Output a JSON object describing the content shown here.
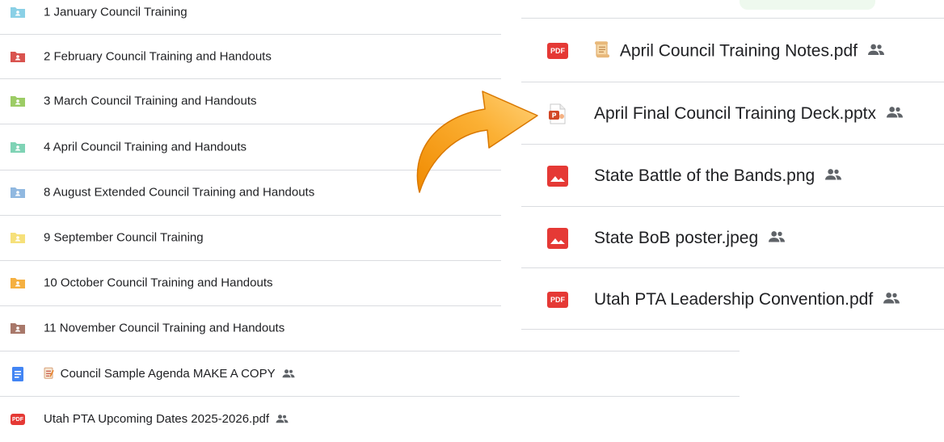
{
  "left_rows": [
    {
      "label": "1 January Council Training",
      "icon": "folder-shared-icon",
      "color": "#8ad0e6"
    },
    {
      "label": "2 February Council Training and Handouts",
      "icon": "folder-shared-icon",
      "color": "#d9534f"
    },
    {
      "label": "3 March Council Training and Handouts",
      "icon": "folder-shared-icon",
      "color": "#9ccc65"
    },
    {
      "label": "4 April Council Training and Handouts",
      "icon": "folder-shared-icon",
      "color": "#7fd3b5"
    },
    {
      "label": "8 August Extended Council Training and Handouts",
      "icon": "folder-shared-icon",
      "color": "#90b8e0"
    },
    {
      "label": "9 September Council Training",
      "icon": "folder-shared-icon",
      "color": "#f6e07a"
    },
    {
      "label": "10 October Council Training and Handouts",
      "icon": "folder-shared-icon",
      "color": "#f5b041"
    },
    {
      "label": "11 November Council Training and Handouts",
      "icon": "folder-shared-icon",
      "color": "#a8786a"
    },
    {
      "label": "Council Sample Agenda MAKE A COPY",
      "icon": "google-doc-icon",
      "color": "#4285f4",
      "emoji": "📝",
      "shared": true
    },
    {
      "label": "Utah PTA Upcoming Dates 2025-2026.pdf",
      "icon": "pdf-icon",
      "color": "#e53935",
      "shared": true
    }
  ],
  "right_rows": [
    {
      "label": "April Council Training Notes.pdf",
      "icon": "pdf-icon",
      "emoji": "📜",
      "shared": true
    },
    {
      "label": "April Final Council Training Deck.pptx",
      "icon": "pptx-icon",
      "shared": true
    },
    {
      "label": "State Battle of the Bands.png",
      "icon": "image-icon",
      "shared": true
    },
    {
      "label": "State BoB poster.jpeg",
      "icon": "image-icon",
      "shared": true
    },
    {
      "label": "Utah PTA Leadership Convention.pdf",
      "icon": "pdf-icon",
      "shared": true
    }
  ],
  "pdf_badge_text": "PDF",
  "colors": {
    "pdf": "#e53935",
    "divider": "#dadce0",
    "arrow": "#f59a1c",
    "shared": "#5f6368"
  }
}
